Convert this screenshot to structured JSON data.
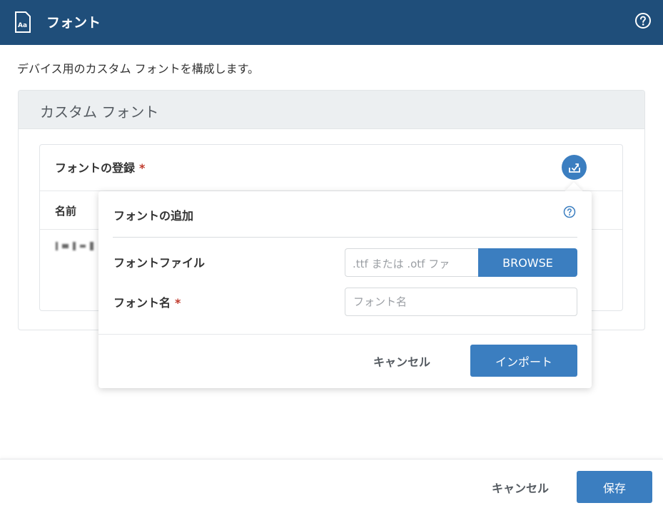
{
  "header": {
    "icon": "font-file-icon",
    "icon_text": "Aa",
    "title": "フォント",
    "help_icon": "help-circle-icon",
    "background_color": "#1f4e7a"
  },
  "description": "デバイス用のカスタム フォントを構成します。",
  "panel": {
    "title": "カスタム フォント",
    "card": {
      "title": "フォントの登録",
      "required_mark": "*",
      "import_icon": "import-icon",
      "column_header": "名前"
    }
  },
  "popover": {
    "title": "フォントの追加",
    "help_icon": "help-circle-icon",
    "font_file_label": "フォントファイル",
    "font_file_placeholder": ".ttf または .otf ファ",
    "browse_label": "BROWSE",
    "font_name_label": "フォント名",
    "font_name_required": "*",
    "font_name_placeholder": "フォント名",
    "cancel_label": "キャンセル",
    "import_label": "インポート"
  },
  "footer": {
    "cancel_label": "キャンセル",
    "save_label": "保存"
  },
  "colors": {
    "accent": "#3b7ec0",
    "required": "#c0392b"
  }
}
